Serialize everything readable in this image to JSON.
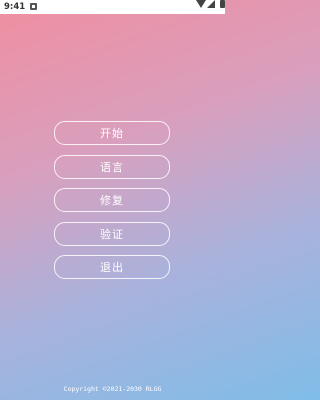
{
  "status_bar": {
    "time": "9:41",
    "icons": [
      "notification-icon",
      "wifi-icon",
      "signal-icon",
      "battery-icon"
    ]
  },
  "menu": {
    "start": "开始",
    "language": "语言",
    "repair": "修复",
    "verify": "验证",
    "exit": "退出"
  },
  "footer": {
    "copyright": "Copyright ©2021-2030 RLGG"
  },
  "colors": {
    "gradient_top": "#f08ea0",
    "gradient_bottom": "#7fbde8",
    "button_border": "#ffffff"
  }
}
